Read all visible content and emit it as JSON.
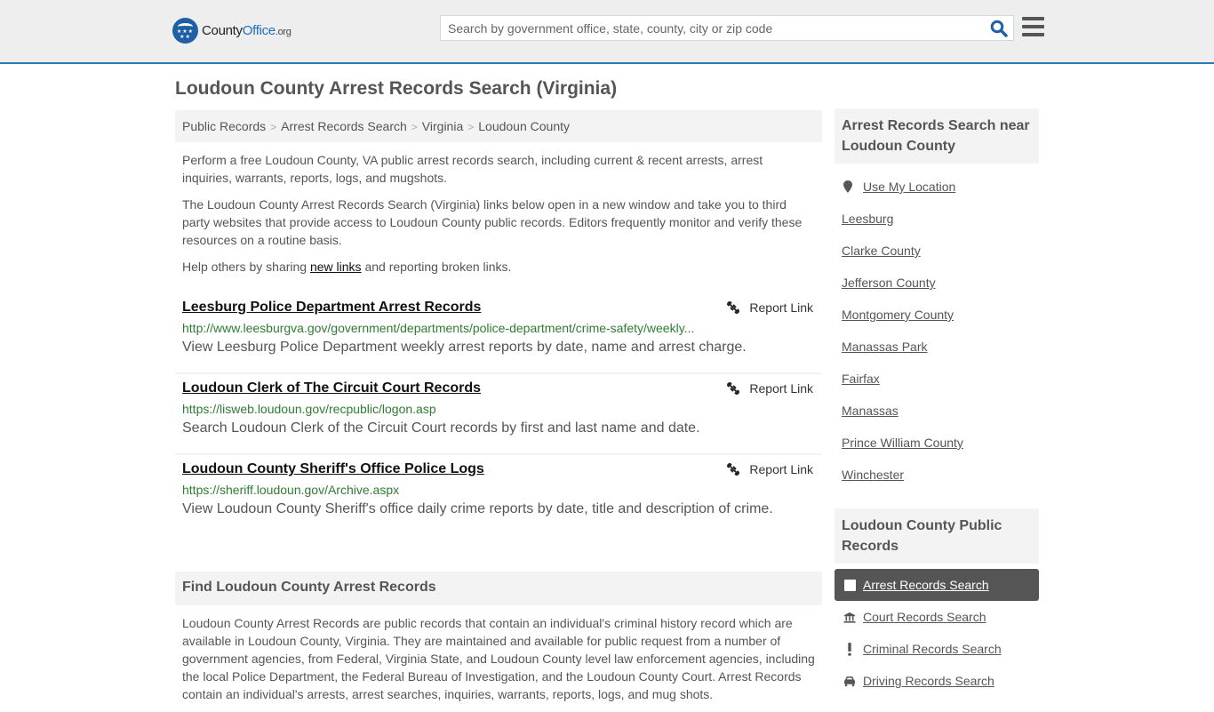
{
  "header": {
    "logo": {
      "brand_prefix": "County",
      "brand_main": "Office",
      "brand_suffix": ".org"
    },
    "search": {
      "placeholder": "Search by government office, state, county, city or zip code",
      "value": ""
    },
    "colors": {
      "accent": "#2c7bb5",
      "logo_blue": "#1f5fa6",
      "search_icon": "#1f5fa6"
    }
  },
  "page": {
    "title": "Loudoun County Arrest Records Search (Virginia)",
    "breadcrumb": [
      "Public Records",
      "Arrest Records Search",
      "Virginia",
      "Loudoun County"
    ],
    "intro": {
      "p1": "Perform a free Loudoun County, VA public arrest records search, including current & recent arrests, arrest inquiries, warrants, reports, logs, and mugshots.",
      "p2": "The Loudoun County Arrest Records Search (Virginia) links below open in a new window and take you to third party websites that provide access to Loudoun County public records. Editors frequently monitor and verify these resources on a routine basis.",
      "p3_before": "Help others by sharing ",
      "p3_link": "new links",
      "p3_after": " and reporting broken links."
    },
    "links": [
      {
        "title": "Leesburg Police Department Arrest Records",
        "url": "http://www.leesburgva.gov/government/departments/police-department/crime-safety/weekly...",
        "description": "View Leesburg Police Department weekly arrest reports by date, name and arrest charge.",
        "report_label": "Report Link"
      },
      {
        "title": "Loudoun Clerk of The Circuit Court Records",
        "url": "https://lisweb.loudoun.gov/recpublic/logon.asp",
        "description": "Search Loudoun Clerk of the Circuit Court records by first and last name and date.",
        "report_label": "Report Link"
      },
      {
        "title": "Loudoun County Sheriff's Office Police Logs",
        "url": "https://sheriff.loudoun.gov/Archive.aspx",
        "description": "View Loudoun County Sheriff's office daily crime reports by date, title and description of crime.",
        "report_label": "Report Link"
      }
    ],
    "find_section": {
      "heading": "Find Loudoun County Arrest Records",
      "body": "Loudoun County Arrest Records are public records that contain an individual's criminal history record which are available in Loudoun County, Virginia. They are maintained and available for public request from a number of government agencies, from Federal, Virginia State, and Loudoun County level law enforcement agencies, including the local Police Department, the Federal Bureau of Investigation, and the Loudoun County Court. Arrest Records contain an individual's arrests, arrest searches, inquiries, warrants, reports, logs, and mug shots."
    }
  },
  "sidebar": {
    "near": {
      "heading": "Arrest Records Search near Loudoun County",
      "use_location": "Use My Location",
      "items": [
        "Leesburg",
        "Clarke County",
        "Jefferson County",
        "Montgomery County",
        "Manassas Park",
        "Fairfax",
        "Manassas",
        "Prince William County",
        "Winchester"
      ]
    },
    "public_records": {
      "heading": "Loudoun County Public Records",
      "items": [
        {
          "label": "Arrest Records Search",
          "icon": "square-icon",
          "active": true
        },
        {
          "label": "Court Records Search",
          "icon": "courthouse-icon",
          "active": false
        },
        {
          "label": "Criminal Records Search",
          "icon": "exclamation-icon",
          "active": false
        },
        {
          "label": "Driving Records Search",
          "icon": "car-icon",
          "active": false
        }
      ]
    }
  }
}
